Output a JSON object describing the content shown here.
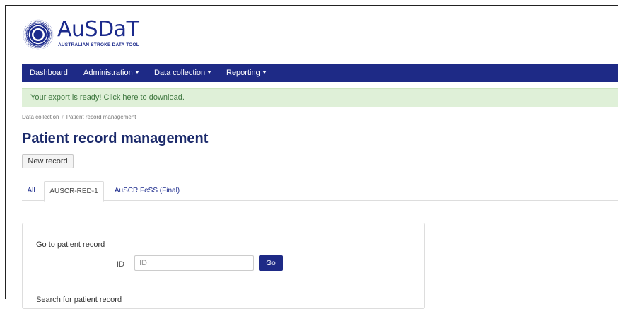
{
  "header": {
    "logo_text": "AuSDaT",
    "logo_subtitle": "AUSTRALIAN STROKE DATA TOOL",
    "brand_color": "#1e2a86"
  },
  "nav": {
    "items": [
      {
        "label": "Dashboard",
        "dropdown": false
      },
      {
        "label": "Administration",
        "dropdown": true
      },
      {
        "label": "Data collection",
        "dropdown": true
      },
      {
        "label": "Reporting",
        "dropdown": true
      }
    ]
  },
  "alert": {
    "text": "Your export is ready! Click here to download.",
    "color": "#dff0d8"
  },
  "breadcrumb": [
    "Data collection",
    "Patient record management"
  ],
  "page": {
    "title": "Patient record management",
    "new_record_label": "New record"
  },
  "tabs": [
    {
      "label": "All",
      "active": false
    },
    {
      "label": "AUSCR-RED-1",
      "active": true
    },
    {
      "label": "AuSCR FeSS (Final)",
      "active": false
    }
  ],
  "go_to_record": {
    "heading": "Go to patient record",
    "id_label": "ID",
    "id_placeholder": "ID",
    "id_value": "",
    "go_label": "Go"
  },
  "search": {
    "heading": "Search for patient record"
  }
}
